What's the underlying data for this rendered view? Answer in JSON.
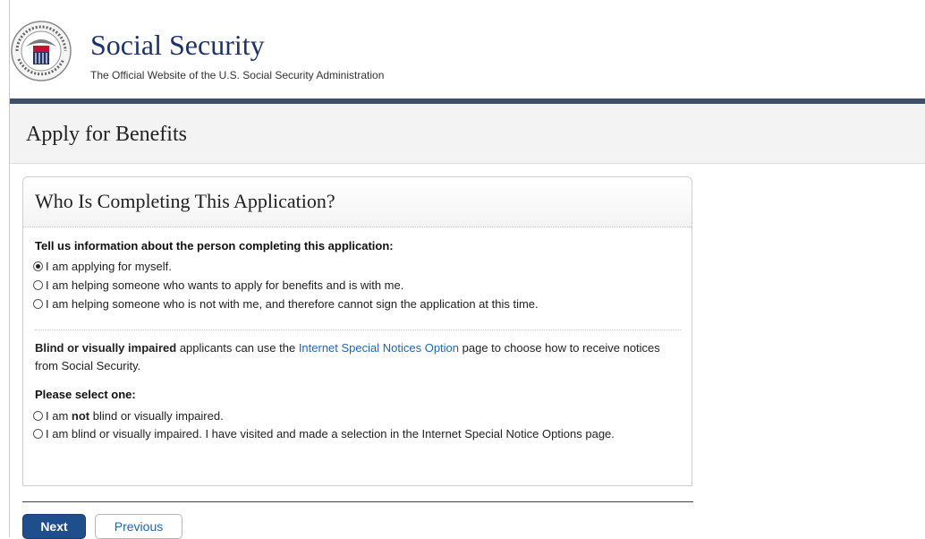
{
  "header": {
    "site_title": "Social Security",
    "site_subtitle": "The Official Website of the U.S. Social Security Administration",
    "seal_icon": "ssa-seal-icon",
    "seal_text": "SOCIAL SECURITY USA ADMINISTRATION",
    "brand_color": "#1f3366",
    "bar_color": "#3d4f6e"
  },
  "page": {
    "title": "Apply for Benefits"
  },
  "card": {
    "title": "Who Is Completing This Application?",
    "question": "Tell us information about the person completing this application:",
    "options": [
      {
        "label": "I am applying for myself.",
        "checked": true
      },
      {
        "label": "I am helping someone who wants to apply for benefits and is with me.",
        "checked": false
      },
      {
        "label": "I am helping someone who is not with me, and therefore cannot sign the application at this time.",
        "checked": false
      }
    ],
    "blind_bold": "Blind or visually impaired",
    "blind_text_1": " applicants can use the ",
    "blind_link": "Internet Special Notices Option",
    "blind_text_2": " page to choose how to receive notices from Social Security.",
    "select_label": "Please select one:",
    "blind_options": [
      {
        "pre": "I am ",
        "bold": "not",
        "post": " blind or visually impaired.",
        "checked": false
      },
      {
        "pre": "I am blind or visually impaired. I have visited and made a selection in the Internet Special Notice Options page.",
        "bold": "",
        "post": "",
        "checked": false
      }
    ]
  },
  "buttons": {
    "next": "Next",
    "previous": "Previous"
  }
}
